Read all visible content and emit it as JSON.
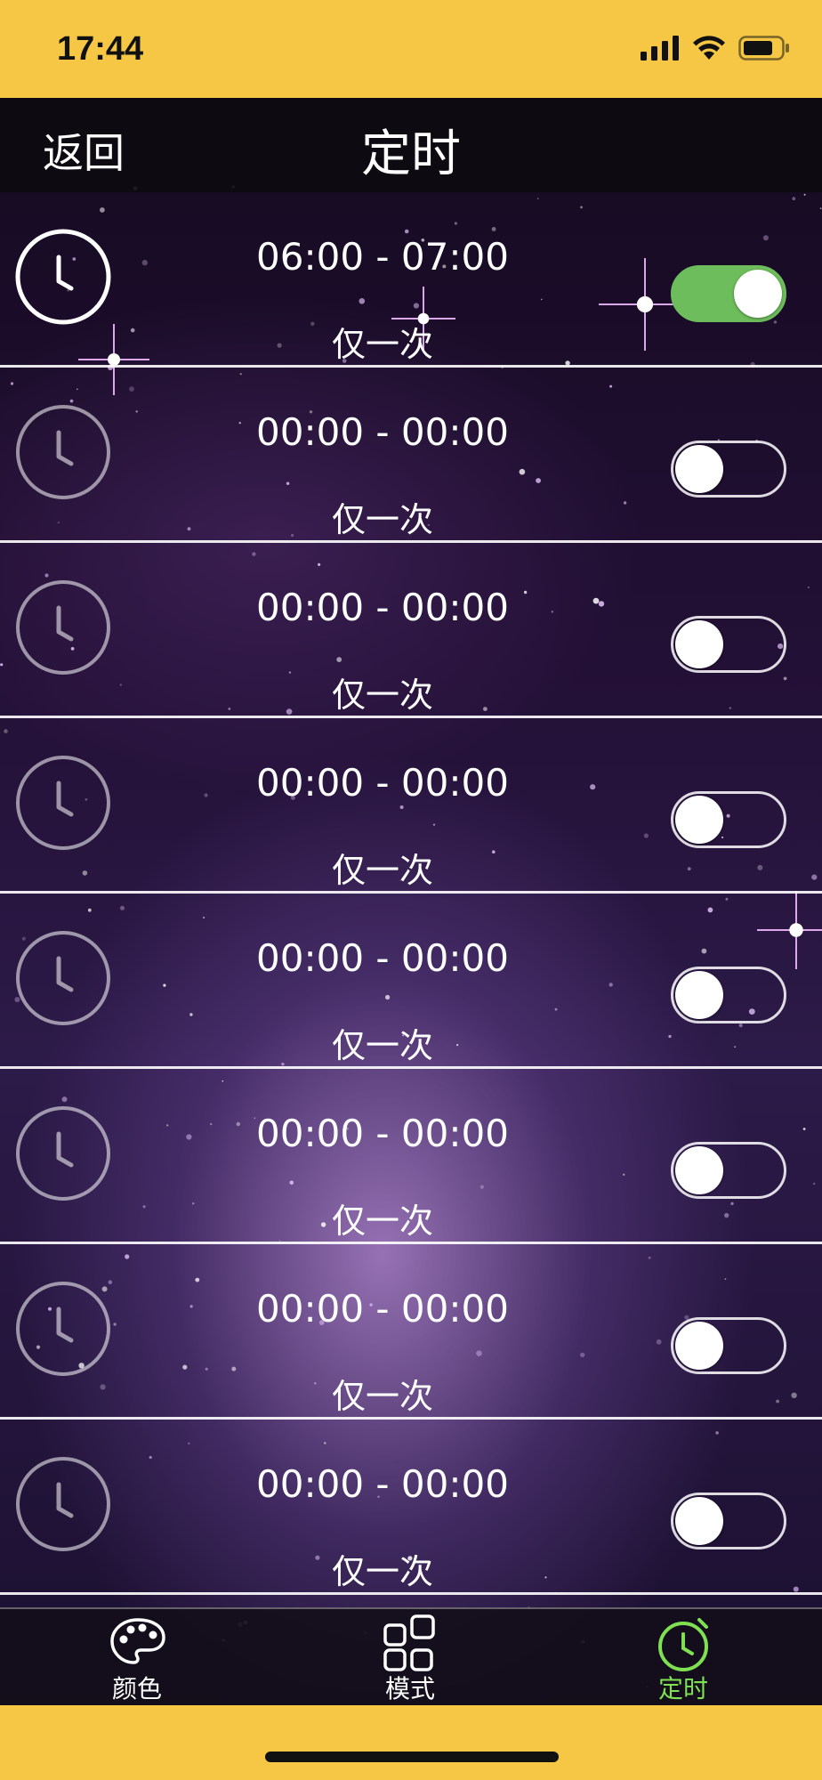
{
  "status_bar": {
    "time": "17:44"
  },
  "nav": {
    "back_label": "返回",
    "title": "定时"
  },
  "timers": [
    {
      "time": "06:00 - 07:00",
      "repeat": "仅一次",
      "enabled": true
    },
    {
      "time": "00:00 - 00:00",
      "repeat": "仅一次",
      "enabled": false
    },
    {
      "time": "00:00 - 00:00",
      "repeat": "仅一次",
      "enabled": false
    },
    {
      "time": "00:00 - 00:00",
      "repeat": "仅一次",
      "enabled": false
    },
    {
      "time": "00:00 - 00:00",
      "repeat": "仅一次",
      "enabled": false
    },
    {
      "time": "00:00 - 00:00",
      "repeat": "仅一次",
      "enabled": false
    },
    {
      "time": "00:00 - 00:00",
      "repeat": "仅一次",
      "enabled": false
    },
    {
      "time": "00:00 - 00:00",
      "repeat": "仅一次",
      "enabled": false
    }
  ],
  "tabs": [
    {
      "label": "颜色",
      "icon": "palette-icon",
      "active": false
    },
    {
      "label": "模式",
      "icon": "grid-icon",
      "active": false
    },
    {
      "label": "定时",
      "icon": "timer-icon",
      "active": true
    }
  ],
  "colors": {
    "accent_green": "#6ebd5c",
    "tab_active": "#7fe052",
    "status_bar_bg": "#f6c745"
  }
}
